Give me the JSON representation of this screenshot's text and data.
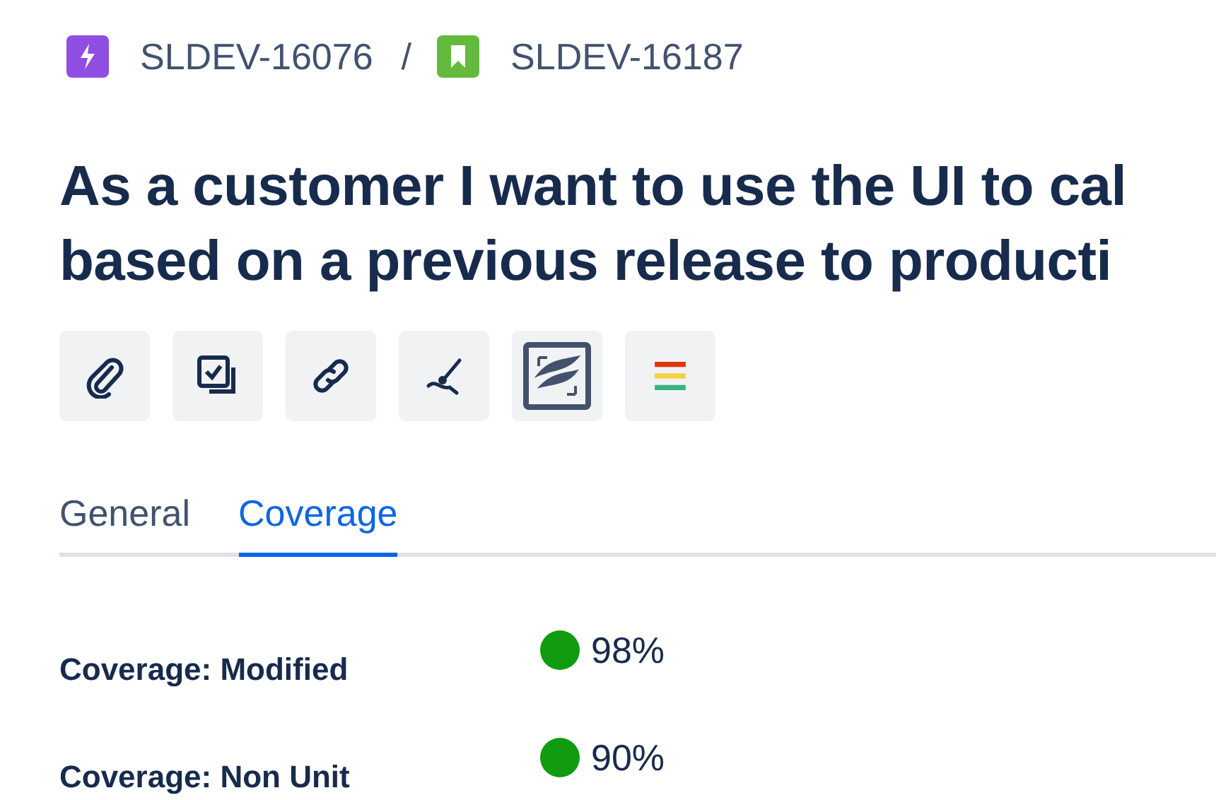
{
  "breadcrumbs": [
    {
      "key": "SLDEV-16076",
      "kind": "epic",
      "color": "#904ee2"
    },
    {
      "key": "SLDEV-16187",
      "kind": "story",
      "color": "#63ba3c"
    }
  ],
  "separator": "/",
  "title_lines": [
    "As a customer I want to use the UI to cal",
    "based on a previous release to producti"
  ],
  "toolbar": [
    {
      "kind": "attach"
    },
    {
      "kind": "subtasks"
    },
    {
      "kind": "link"
    },
    {
      "kind": "brush"
    },
    {
      "kind": "framed"
    },
    {
      "kind": "traffic"
    }
  ],
  "tabs": [
    {
      "label": "General",
      "selected": false
    },
    {
      "label": "Coverage",
      "selected": true
    }
  ],
  "fields": [
    {
      "label": "Coverage: Modified",
      "value": "98%",
      "color": "#109b10"
    },
    {
      "label": "Coverage: Non Unit",
      "value": "90%",
      "color": "#109b10"
    }
  ]
}
